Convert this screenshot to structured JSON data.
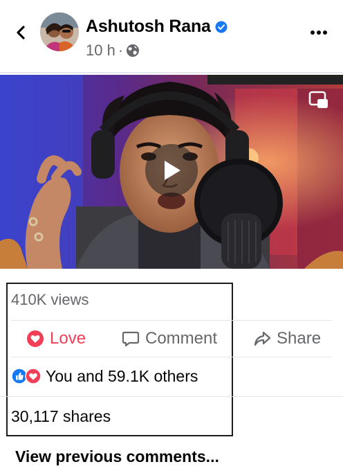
{
  "post": {
    "author": "Ashutosh Rana",
    "time": "10 h",
    "separator": "·"
  },
  "stats": {
    "views": "410K views",
    "reactions_text": "You and 59.1K others",
    "shares": "30,117 shares"
  },
  "actions": {
    "love_label": "Love",
    "comment_label": "Comment",
    "share_label": "Share"
  },
  "comments": {
    "view_previous": "View previous comments..."
  },
  "colors": {
    "love": "#f33e58",
    "verified": "#1877f2",
    "like_reaction": "#1877f2",
    "secondary_text": "#65676b"
  },
  "icons": {
    "back": "chevron-left-icon",
    "verified": "verified-badge-icon",
    "privacy": "globe-icon",
    "more": "more-options-icon",
    "play": "play-icon",
    "pip": "picture-in-picture-icon",
    "love": "heart-icon",
    "comment": "comment-bubble-icon",
    "share": "share-arrow-icon",
    "like_reaction": "like-reaction-icon",
    "love_reaction": "love-reaction-icon"
  }
}
